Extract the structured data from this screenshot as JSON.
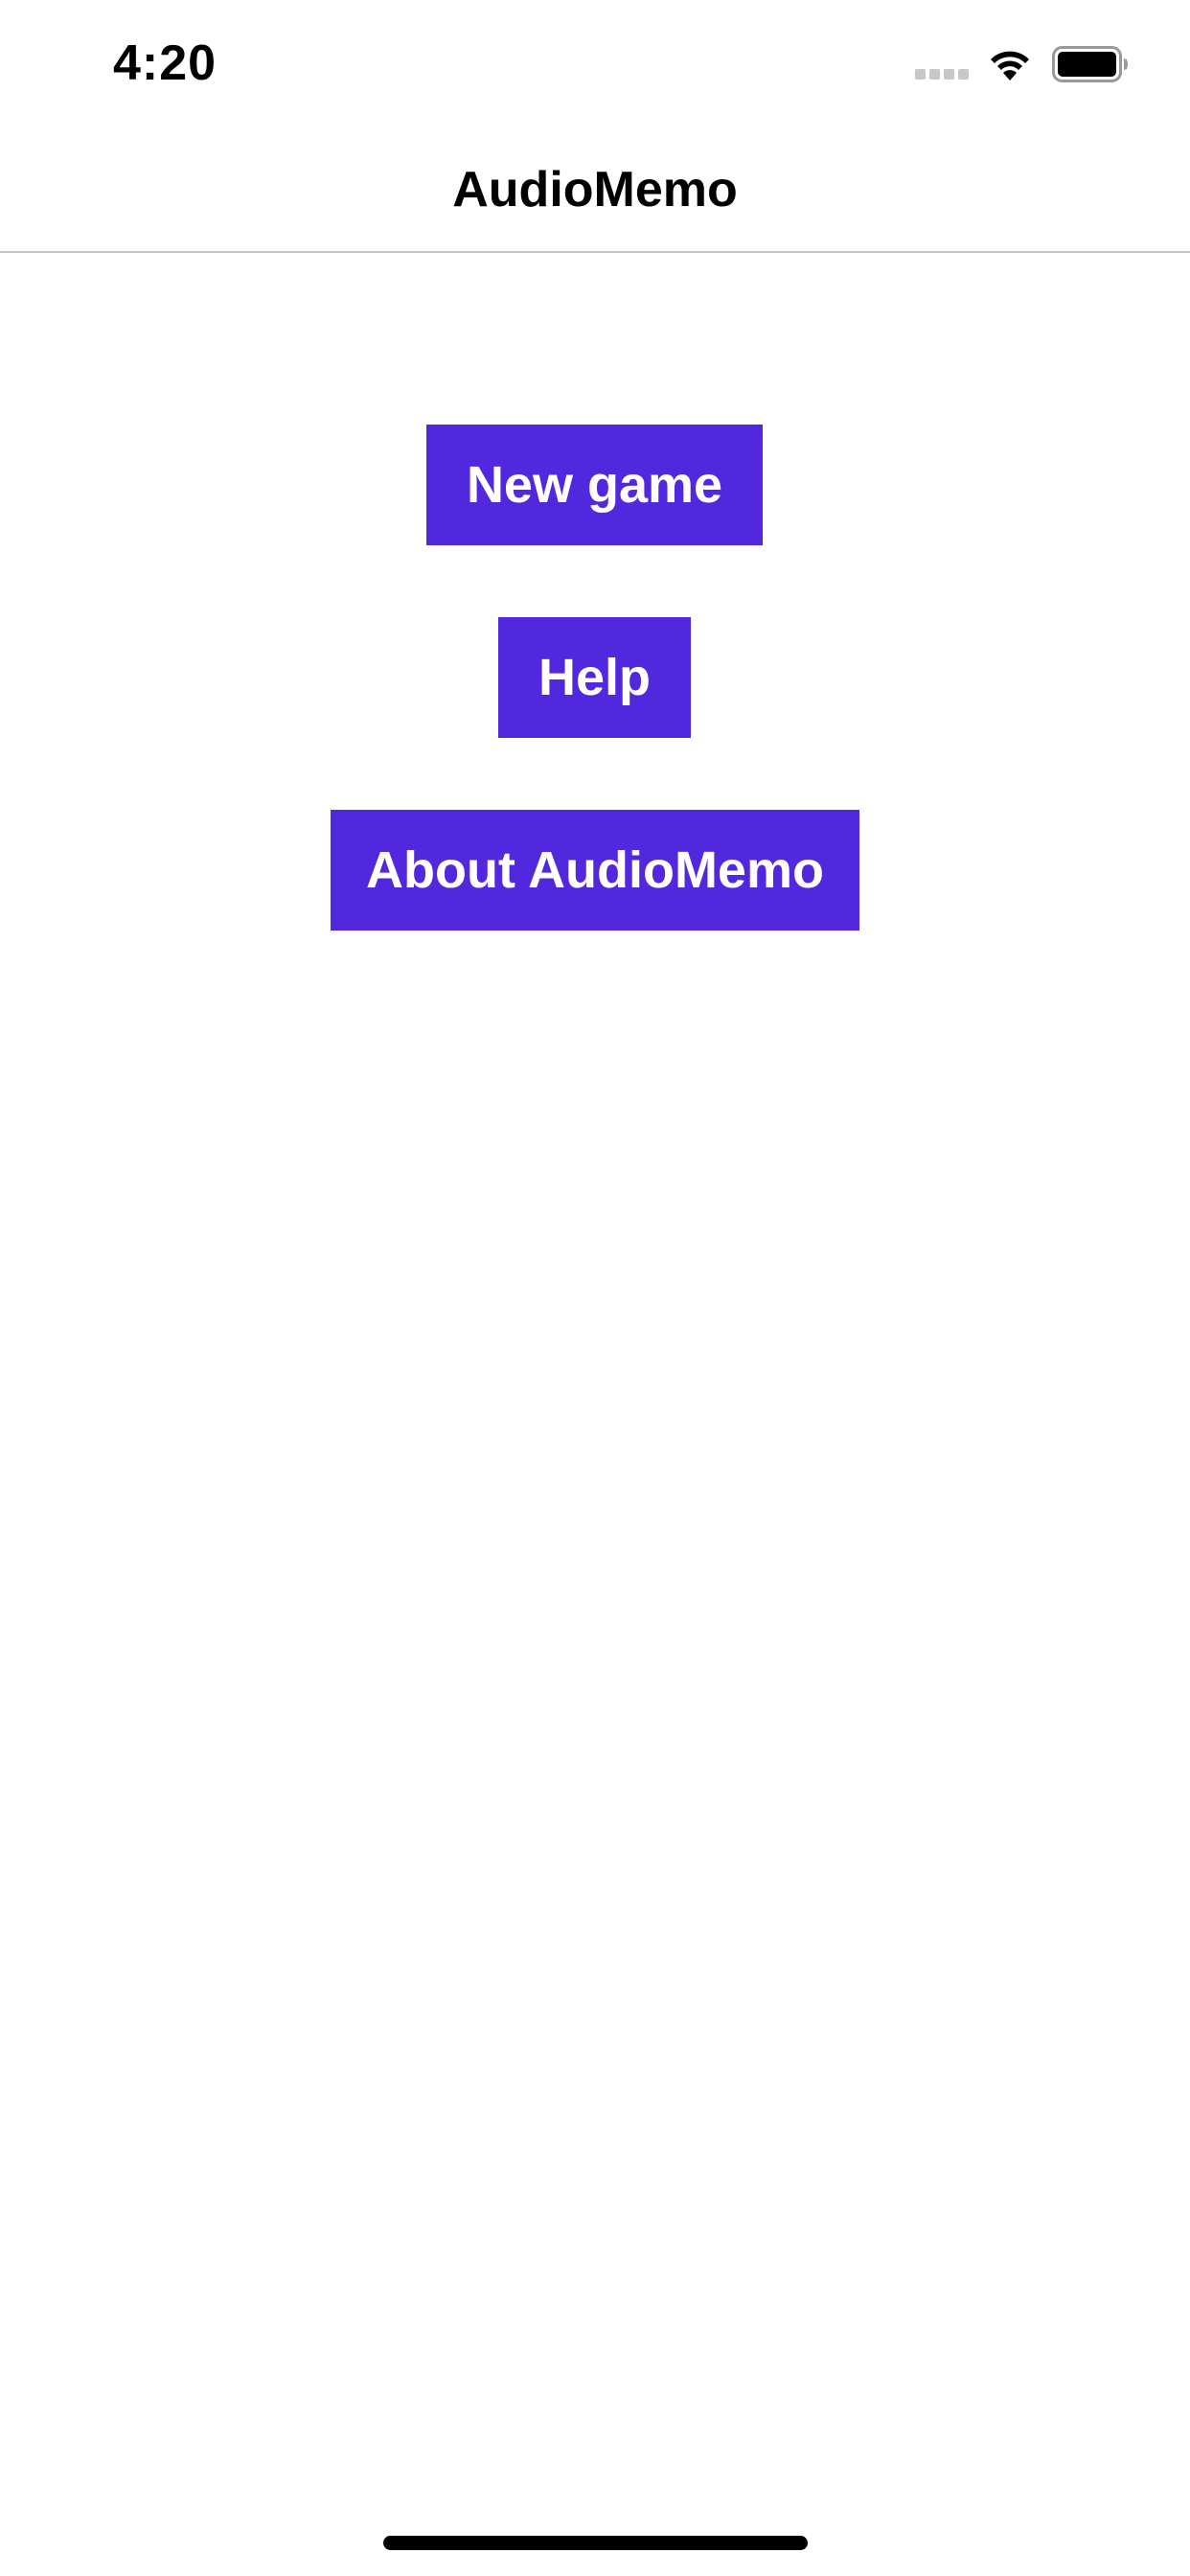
{
  "status_bar": {
    "time": "4:20",
    "signal_icon": "cellular-signal-icon",
    "wifi_icon": "wifi-icon",
    "battery_icon": "battery-icon"
  },
  "nav_bar": {
    "title": "AudioMemo"
  },
  "menu": {
    "new_game_label": "New game",
    "help_label": "Help",
    "about_label": "About AudioMemo"
  },
  "colors": {
    "accent": "#5128de",
    "background": "#ffffff",
    "text": "#000000"
  }
}
